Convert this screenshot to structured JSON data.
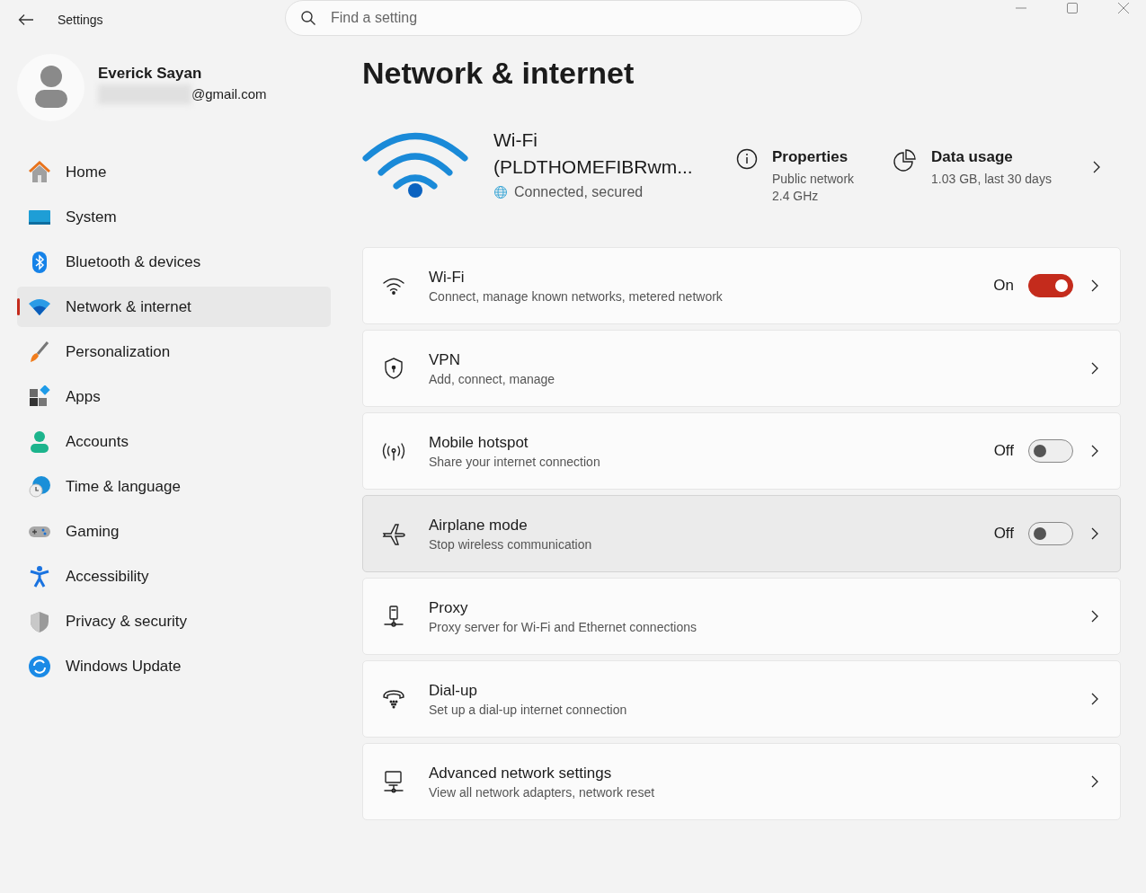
{
  "window": {
    "title": "Settings"
  },
  "search": {
    "placeholder": "Find a setting"
  },
  "account": {
    "name": "Everick Sayan",
    "email": "@gmail.com"
  },
  "sidebar": {
    "items": [
      {
        "label": "Home",
        "selected": false
      },
      {
        "label": "System",
        "selected": false
      },
      {
        "label": "Bluetooth & devices",
        "selected": false
      },
      {
        "label": "Network & internet",
        "selected": true
      },
      {
        "label": "Personalization",
        "selected": false
      },
      {
        "label": "Apps",
        "selected": false
      },
      {
        "label": "Accounts",
        "selected": false
      },
      {
        "label": "Time & language",
        "selected": false
      },
      {
        "label": "Gaming",
        "selected": false
      },
      {
        "label": "Accessibility",
        "selected": false
      },
      {
        "label": "Privacy & security",
        "selected": false
      },
      {
        "label": "Windows Update",
        "selected": false
      }
    ]
  },
  "page": {
    "title": "Network & internet"
  },
  "connection": {
    "name": "Wi-Fi (PLDTHOMEFIBRwm...",
    "status": "Connected, secured",
    "properties": {
      "title": "Properties",
      "lines": [
        "Public network",
        "2.4 GHz"
      ]
    },
    "data_usage": {
      "title": "Data usage",
      "detail": "1.03 GB, last 30 days"
    }
  },
  "rows": [
    {
      "title": "Wi-Fi",
      "subtitle": "Connect, manage known networks, metered network",
      "hovered": false,
      "toggle": {
        "label": "On",
        "on": true
      }
    },
    {
      "title": "VPN",
      "subtitle": "Add, connect, manage",
      "hovered": false
    },
    {
      "title": "Mobile hotspot",
      "subtitle": "Share your internet connection",
      "hovered": false,
      "toggle": {
        "label": "Off",
        "on": false
      }
    },
    {
      "title": "Airplane mode",
      "subtitle": "Stop wireless communication",
      "hovered": true,
      "toggle": {
        "label": "Off",
        "on": false
      }
    },
    {
      "title": "Proxy",
      "subtitle": "Proxy server for Wi-Fi and Ethernet connections",
      "hovered": false
    },
    {
      "title": "Dial-up",
      "subtitle": "Set up a dial-up internet connection",
      "hovered": false
    },
    {
      "title": "Advanced network settings",
      "subtitle": "View all network adapters, network reset",
      "hovered": false
    }
  ]
}
